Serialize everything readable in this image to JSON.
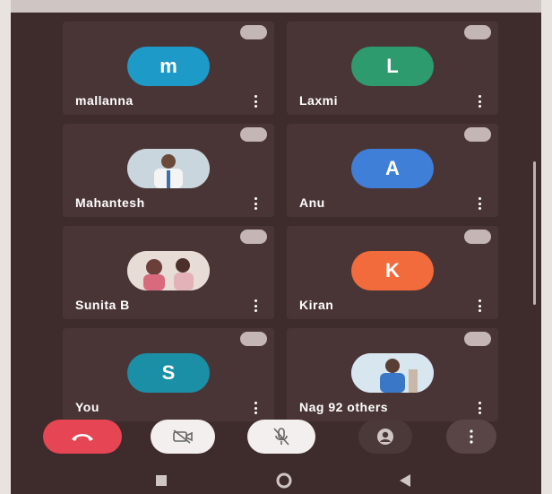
{
  "participants": [
    {
      "name": "mallanna",
      "initial": "m",
      "color": "#1e9ac8",
      "type": "letter"
    },
    {
      "name": "Laxmi",
      "initial": "L",
      "color": "#2e9b6e",
      "type": "letter"
    },
    {
      "name": "Mahantesh",
      "initial": "",
      "color": "#d9d4cf",
      "type": "photo"
    },
    {
      "name": "Anu",
      "initial": "A",
      "color": "#3f7fd8",
      "type": "letter"
    },
    {
      "name": "Sunita B",
      "initial": "",
      "color": "#d9d4cf",
      "type": "photo"
    },
    {
      "name": "Kiran",
      "initial": "K",
      "color": "#f26b3c",
      "type": "letter"
    },
    {
      "name": "You",
      "initial": "S",
      "color": "#1a8fa6",
      "type": "letter"
    },
    {
      "name": "Nag  92 others",
      "initial": "",
      "color": "#d9d4cf",
      "type": "photo"
    }
  ],
  "controls": {
    "end_call_color": "#e64553",
    "camera_off_color": "#f3efee",
    "mic_off_color": "#f3efee",
    "more_color": "#5a4546"
  },
  "icons": {
    "end_call": "phone-hangup-icon",
    "camera": "video-off-icon",
    "mic": "mic-off-icon",
    "effects": "avatar-icon",
    "more": "more-vertical-icon"
  }
}
